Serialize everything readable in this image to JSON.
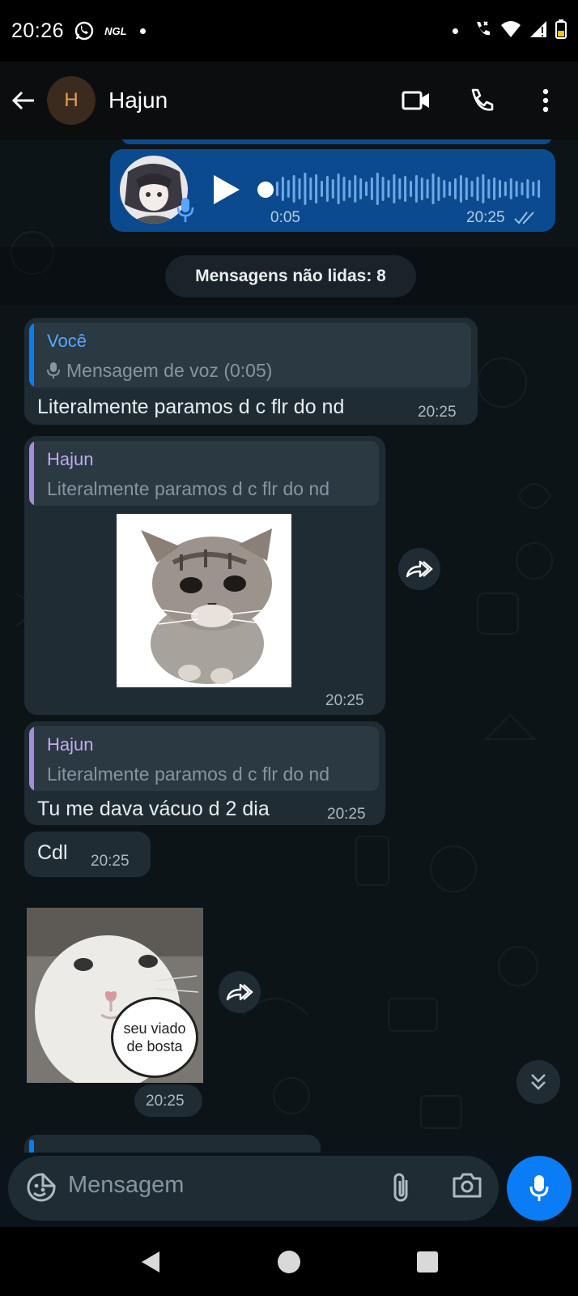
{
  "status_bar": {
    "time": "20:26",
    "app_badge": "NGL"
  },
  "header": {
    "avatar_initial": "H",
    "contact_name": "Hajun"
  },
  "colors": {
    "outgoing_bubble": "#0b4a8f",
    "incoming_bubble": "#1f2c34",
    "accent": "#0a7cf5",
    "quote_self": "#0a7cf5",
    "quote_contact": "#a98bd8"
  },
  "voice_message": {
    "duration": "0:05",
    "time": "20:25",
    "status": "read"
  },
  "unread_label": "Mensagens não lidas: 8",
  "messages": [
    {
      "quote": {
        "author": "Você",
        "text": "Mensagem de voz (0:05)"
      },
      "text": "Literalmente paramos d c flr do nd",
      "time": "20:25"
    },
    {
      "quote": {
        "author": "Hajun",
        "text": "Literalmente paramos d c flr do nd"
      },
      "sticker": "kitten-sticker",
      "time": "20:25"
    },
    {
      "quote": {
        "author": "Hajun",
        "text": "Literalmente paramos d c flr do nd"
      },
      "text": "Tu me dava vácuo d 2 dia",
      "time": "20:25"
    },
    {
      "text": "Cdl",
      "time": "20:25"
    },
    {
      "sticker": "bunny-sticker",
      "sticker_caption": "seu viado de bosta",
      "sticker_caption_line1": "seu viado",
      "sticker_caption_line2": "de bosta",
      "time": "20:25"
    }
  ],
  "input": {
    "placeholder": "Mensagem"
  }
}
